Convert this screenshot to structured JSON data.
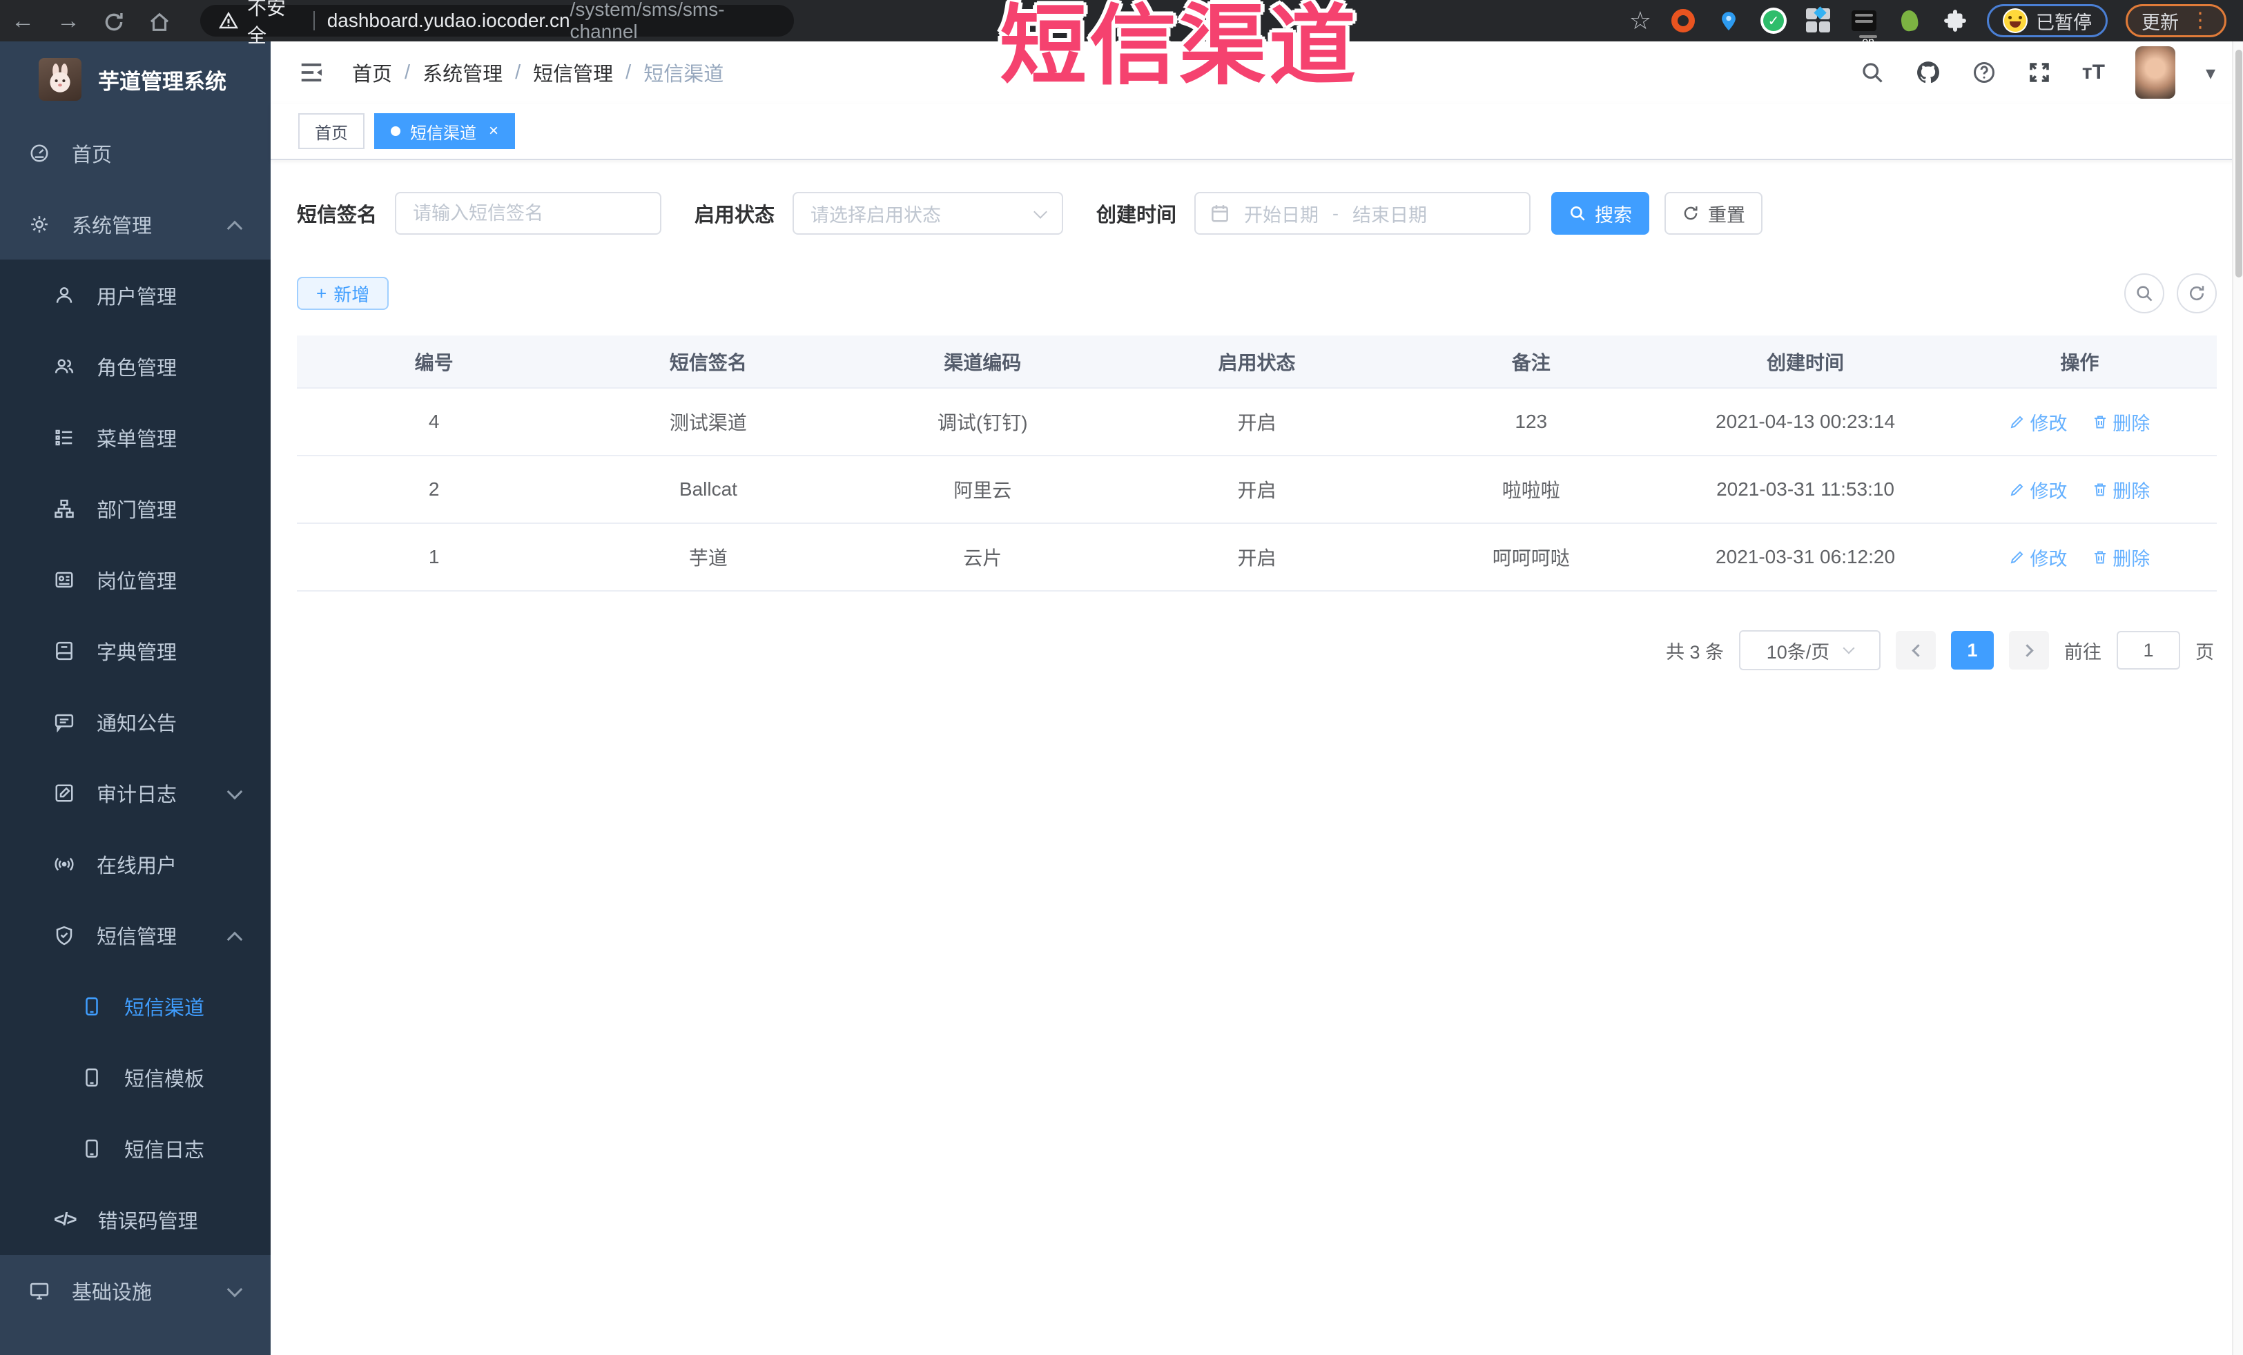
{
  "browser": {
    "not_secure_label": "不安全",
    "url_domain": "dashboard.yudao.iocoder.cn",
    "url_path": "/system/sms/sms-channel",
    "paused_label": "已暂停",
    "update_label": "更新"
  },
  "overlay_title": "短信渠道",
  "sidebar": {
    "title": "芋道管理系统",
    "items": [
      {
        "label": "首页"
      },
      {
        "label": "系统管理"
      },
      {
        "label": "用户管理"
      },
      {
        "label": "角色管理"
      },
      {
        "label": "菜单管理"
      },
      {
        "label": "部门管理"
      },
      {
        "label": "岗位管理"
      },
      {
        "label": "字典管理"
      },
      {
        "label": "通知公告"
      },
      {
        "label": "审计日志"
      },
      {
        "label": "在线用户"
      },
      {
        "label": "短信管理"
      },
      {
        "label": "短信渠道"
      },
      {
        "label": "短信模板"
      },
      {
        "label": "短信日志"
      },
      {
        "label": "错误码管理"
      },
      {
        "label": "基础设施"
      }
    ]
  },
  "header": {
    "breadcrumb": [
      "首页",
      "系统管理",
      "短信管理",
      "短信渠道"
    ]
  },
  "tabs": [
    {
      "label": "首页"
    },
    {
      "label": "短信渠道"
    }
  ],
  "filters": {
    "sign_label": "短信签名",
    "sign_placeholder": "请输入短信签名",
    "status_label": "启用状态",
    "status_placeholder": "请选择启用状态",
    "time_label": "创建时间",
    "start_placeholder": "开始日期",
    "range_separator": "-",
    "end_placeholder": "结束日期",
    "search_label": "搜索",
    "reset_label": "重置"
  },
  "toolbar": {
    "add_label": "新增"
  },
  "table": {
    "columns": [
      "编号",
      "短信签名",
      "渠道编码",
      "启用状态",
      "备注",
      "创建时间",
      "操作"
    ],
    "rows": [
      {
        "id": "4",
        "sign": "测试渠道",
        "code": "调试(钉钉)",
        "status": "开启",
        "remark": "123",
        "created": "2021-04-13 00:23:14"
      },
      {
        "id": "2",
        "sign": "Ballcat",
        "code": "阿里云",
        "status": "开启",
        "remark": "啦啦啦",
        "created": "2021-03-31 11:53:10"
      },
      {
        "id": "1",
        "sign": "芋道",
        "code": "云片",
        "status": "开启",
        "remark": "呵呵呵哒",
        "created": "2021-03-31 06:12:20"
      }
    ],
    "edit_label": "修改",
    "delete_label": "删除"
  },
  "pagination": {
    "total_label": "共 3 条",
    "page_size_label": "10条/页",
    "current_page": "1",
    "goto_label": "前往",
    "goto_value": "1",
    "unit_label": "页"
  },
  "colors": {
    "primary": "#409EFF",
    "overlay_pink": "#f5426f",
    "sidebar_bg": "#304156",
    "submenu_bg": "#1f2d3d"
  }
}
